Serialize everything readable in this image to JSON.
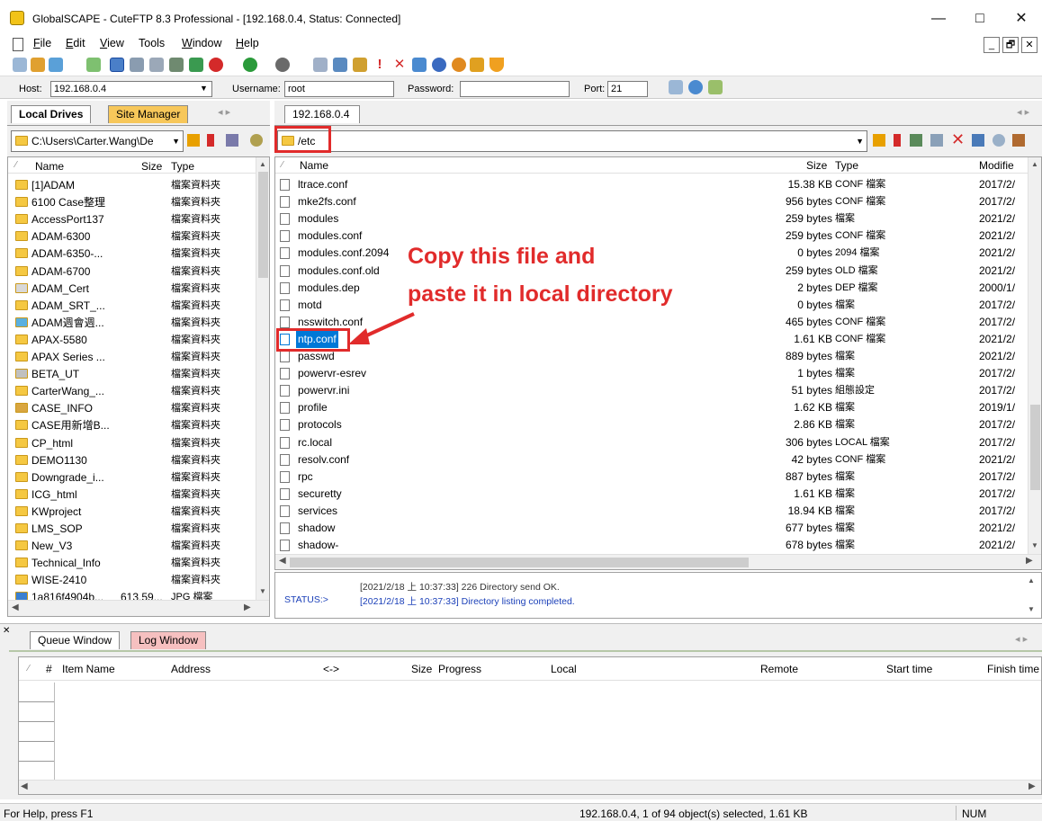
{
  "window": {
    "title": "GlobalSCAPE - CuteFTP 8.3 Professional - [192.168.0.4, Status: Connected]",
    "minimize": "—",
    "maximize": "□",
    "close": "✕"
  },
  "menu": {
    "items": [
      {
        "key": "F",
        "rest": "ile"
      },
      {
        "key": "E",
        "rest": "dit"
      },
      {
        "key": "V",
        "rest": "iew"
      },
      {
        "key": "To",
        "rest": "ols",
        "underline_index": 1
      },
      {
        "key": "W",
        "rest": "indow"
      },
      {
        "key": "H",
        "rest": "elp"
      }
    ],
    "mdi_buttons": [
      "_",
      "🗗",
      "✕"
    ]
  },
  "quickconnect": {
    "host_label": "Host:",
    "host_value": "192.168.0.4",
    "username_label": "Username:",
    "username_value": "root",
    "password_label": "Password:",
    "password_value": "",
    "port_label": "Port:",
    "port_value": "21"
  },
  "left_pane": {
    "tabs": [
      "Local Drives",
      "Site Manager"
    ],
    "path": "C:\\Users\\Carter.Wang\\De",
    "columns": {
      "name": "Name",
      "size": "Size",
      "type": "Type"
    },
    "rows": [
      {
        "name": "[1]ADAM",
        "size": "",
        "type": "檔案資料夾",
        "icon": "folder"
      },
      {
        "name": "6100 Case整理",
        "size": "",
        "type": "檔案資料夾",
        "icon": "folder"
      },
      {
        "name": "AccessPort137",
        "size": "",
        "type": "檔案資料夾",
        "icon": "folder"
      },
      {
        "name": "ADAM-6300",
        "size": "",
        "type": "檔案資料夾",
        "icon": "folder"
      },
      {
        "name": "ADAM-6350-...",
        "size": "",
        "type": "檔案資料夾",
        "icon": "folder"
      },
      {
        "name": "ADAM-6700",
        "size": "",
        "type": "檔案資料夾",
        "icon": "folder"
      },
      {
        "name": "ADAM_Cert",
        "size": "",
        "type": "檔案資料夾",
        "icon": "shortcut"
      },
      {
        "name": "ADAM_SRT_...",
        "size": "",
        "type": "檔案資料夾",
        "icon": "folder"
      },
      {
        "name": "ADAM週會週...",
        "size": "",
        "type": "檔案資料夾",
        "icon": "color"
      },
      {
        "name": "APAX-5580",
        "size": "",
        "type": "檔案資料夾",
        "icon": "folder"
      },
      {
        "name": "APAX Series ...",
        "size": "",
        "type": "檔案資料夾",
        "icon": "folder"
      },
      {
        "name": "BETA_UT",
        "size": "",
        "type": "檔案資料夾",
        "icon": "user"
      },
      {
        "name": "CarterWang_...",
        "size": "",
        "type": "檔案資料夾",
        "icon": "folder"
      },
      {
        "name": "CASE_INFO",
        "size": "",
        "type": "檔案資料夾",
        "icon": "special"
      },
      {
        "name": "CASE用新增B...",
        "size": "",
        "type": "檔案資料夾",
        "icon": "folder"
      },
      {
        "name": "CP_html",
        "size": "",
        "type": "檔案資料夾",
        "icon": "folder"
      },
      {
        "name": "DEMO1130",
        "size": "",
        "type": "檔案資料夾",
        "icon": "folder"
      },
      {
        "name": "Downgrade_i...",
        "size": "",
        "type": "檔案資料夾",
        "icon": "folder"
      },
      {
        "name": "ICG_html",
        "size": "",
        "type": "檔案資料夾",
        "icon": "folder"
      },
      {
        "name": "KWproject",
        "size": "",
        "type": "檔案資料夾",
        "icon": "folder"
      },
      {
        "name": "LMS_SOP",
        "size": "",
        "type": "檔案資料夾",
        "icon": "folder"
      },
      {
        "name": "New_V3",
        "size": "",
        "type": "檔案資料夾",
        "icon": "folder"
      },
      {
        "name": "Technical_Info",
        "size": "",
        "type": "檔案資料夾",
        "icon": "folder"
      },
      {
        "name": "WISE-2410",
        "size": "",
        "type": "檔案資料夾",
        "icon": "folder"
      },
      {
        "name": "1a816f4904b...",
        "size": "613.59...",
        "type": "JPG 檔案",
        "icon": "image"
      }
    ]
  },
  "right_pane": {
    "tab": "192.168.0.4",
    "path": "/etc",
    "columns": {
      "name": "Name",
      "size": "Size",
      "type": "Type",
      "modified": "Modifie"
    },
    "rows": [
      {
        "name": "ltrace.conf",
        "size": "15.38 KB",
        "type": "CONF 檔案",
        "modified": "2017/2/"
      },
      {
        "name": "mke2fs.conf",
        "size": "956 bytes",
        "type": "CONF 檔案",
        "modified": "2017/2/"
      },
      {
        "name": "modules",
        "size": "259 bytes",
        "type": "檔案",
        "modified": "2021/2/"
      },
      {
        "name": "modules.conf",
        "size": "259 bytes",
        "type": "CONF 檔案",
        "modified": "2021/2/"
      },
      {
        "name": "modules.conf.2094",
        "size": "0 bytes",
        "type": "2094 檔案",
        "modified": "2021/2/"
      },
      {
        "name": "modules.conf.old",
        "size": "259 bytes",
        "type": "OLD 檔案",
        "modified": "2021/2/"
      },
      {
        "name": "modules.dep",
        "size": "2 bytes",
        "type": "DEP 檔案",
        "modified": "2000/1/"
      },
      {
        "name": "motd",
        "size": "0 bytes",
        "type": "檔案",
        "modified": "2017/2/"
      },
      {
        "name": "nsswitch.conf",
        "size": "465 bytes",
        "type": "CONF 檔案",
        "modified": "2017/2/"
      },
      {
        "name": "ntp.conf",
        "size": "1.61 KB",
        "type": "CONF 檔案",
        "modified": "2021/2/",
        "selected": true
      },
      {
        "name": "passwd",
        "size": "889 bytes",
        "type": "檔案",
        "modified": "2021/2/"
      },
      {
        "name": "powervr-esrev",
        "size": "1 bytes",
        "type": "檔案",
        "modified": "2017/2/"
      },
      {
        "name": "powervr.ini",
        "size": "51 bytes",
        "type": "組態設定",
        "modified": "2017/2/"
      },
      {
        "name": "profile",
        "size": "1.62 KB",
        "type": "檔案",
        "modified": "2019/1/"
      },
      {
        "name": "protocols",
        "size": "2.86 KB",
        "type": "檔案",
        "modified": "2017/2/"
      },
      {
        "name": "rc.local",
        "size": "306 bytes",
        "type": "LOCAL 檔案",
        "modified": "2017/2/"
      },
      {
        "name": "resolv.conf",
        "size": "42 bytes",
        "type": "CONF 檔案",
        "modified": "2021/2/"
      },
      {
        "name": "rpc",
        "size": "887 bytes",
        "type": "檔案",
        "modified": "2017/2/"
      },
      {
        "name": "securetty",
        "size": "1.61 KB",
        "type": "檔案",
        "modified": "2017/2/"
      },
      {
        "name": "services",
        "size": "18.94 KB",
        "type": "檔案",
        "modified": "2017/2/"
      },
      {
        "name": "shadow",
        "size": "677 bytes",
        "type": "檔案",
        "modified": "2021/2/"
      },
      {
        "name": "shadow-",
        "size": "678 bytes",
        "type": "檔案",
        "modified": "2021/2/"
      }
    ]
  },
  "annotation": {
    "line1": "Copy this file and",
    "line2": "paste it in local directory"
  },
  "log": {
    "line1": "[2021/2/18 上 10:37:33] 226 Directory send OK.",
    "status_label": "STATUS:>",
    "line2": "[2021/2/18 上 10:37:33] Directory listing completed."
  },
  "queue": {
    "tabs": [
      "Queue Window",
      "Log Window"
    ],
    "columns": [
      "#",
      "Item Name",
      "Address",
      "<->",
      "Size",
      "Progress",
      "Local",
      "Remote",
      "Start time",
      "Finish time"
    ]
  },
  "statusbar": {
    "help": "For Help, press F1",
    "selection": "192.168.0.4, 1 of 94 object(s) selected, 1.61 KB",
    "num": "NUM"
  }
}
